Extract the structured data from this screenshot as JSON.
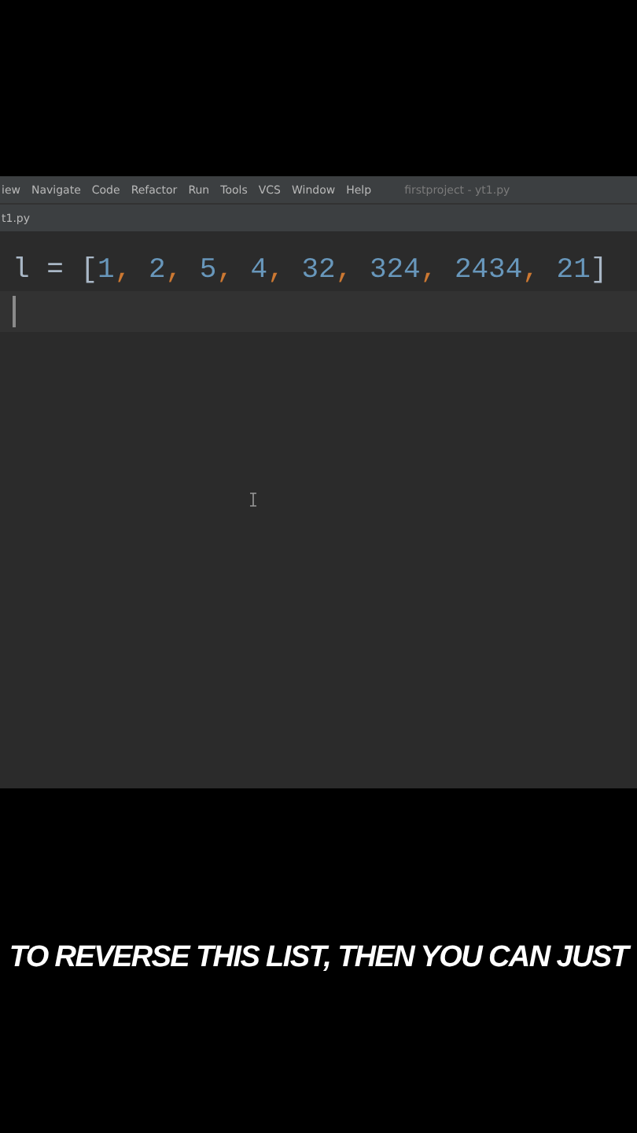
{
  "menu_bar": {
    "items": [
      "iew",
      "Navigate",
      "Code",
      "Refactor",
      "Run",
      "Tools",
      "VCS",
      "Window",
      "Help"
    ],
    "title": "firstproject - yt1.py"
  },
  "tab": {
    "label": "t1.py"
  },
  "editor": {
    "lines": [
      {
        "current": false,
        "tokens": [
          {
            "kind": "ident",
            "text": "l"
          },
          {
            "kind": "plain",
            "text": " = "
          },
          {
            "kind": "bracket",
            "text": "["
          },
          {
            "kind": "number",
            "text": "1"
          },
          {
            "kind": "comma",
            "text": ", "
          },
          {
            "kind": "number",
            "text": "2"
          },
          {
            "kind": "comma",
            "text": ", "
          },
          {
            "kind": "number",
            "text": "5"
          },
          {
            "kind": "comma",
            "text": ", "
          },
          {
            "kind": "number",
            "text": "4"
          },
          {
            "kind": "comma",
            "text": ", "
          },
          {
            "kind": "number",
            "text": "32"
          },
          {
            "kind": "comma",
            "text": ", "
          },
          {
            "kind": "number",
            "text": "324"
          },
          {
            "kind": "comma",
            "text": ", "
          },
          {
            "kind": "number",
            "text": "2434"
          },
          {
            "kind": "comma",
            "text": ", "
          },
          {
            "kind": "number",
            "text": "21"
          },
          {
            "kind": "bracket",
            "text": "]"
          }
        ]
      },
      {
        "current": true
      }
    ]
  },
  "caption": "TO REVERSE THIS LIST, THEN YOU CAN JUST"
}
